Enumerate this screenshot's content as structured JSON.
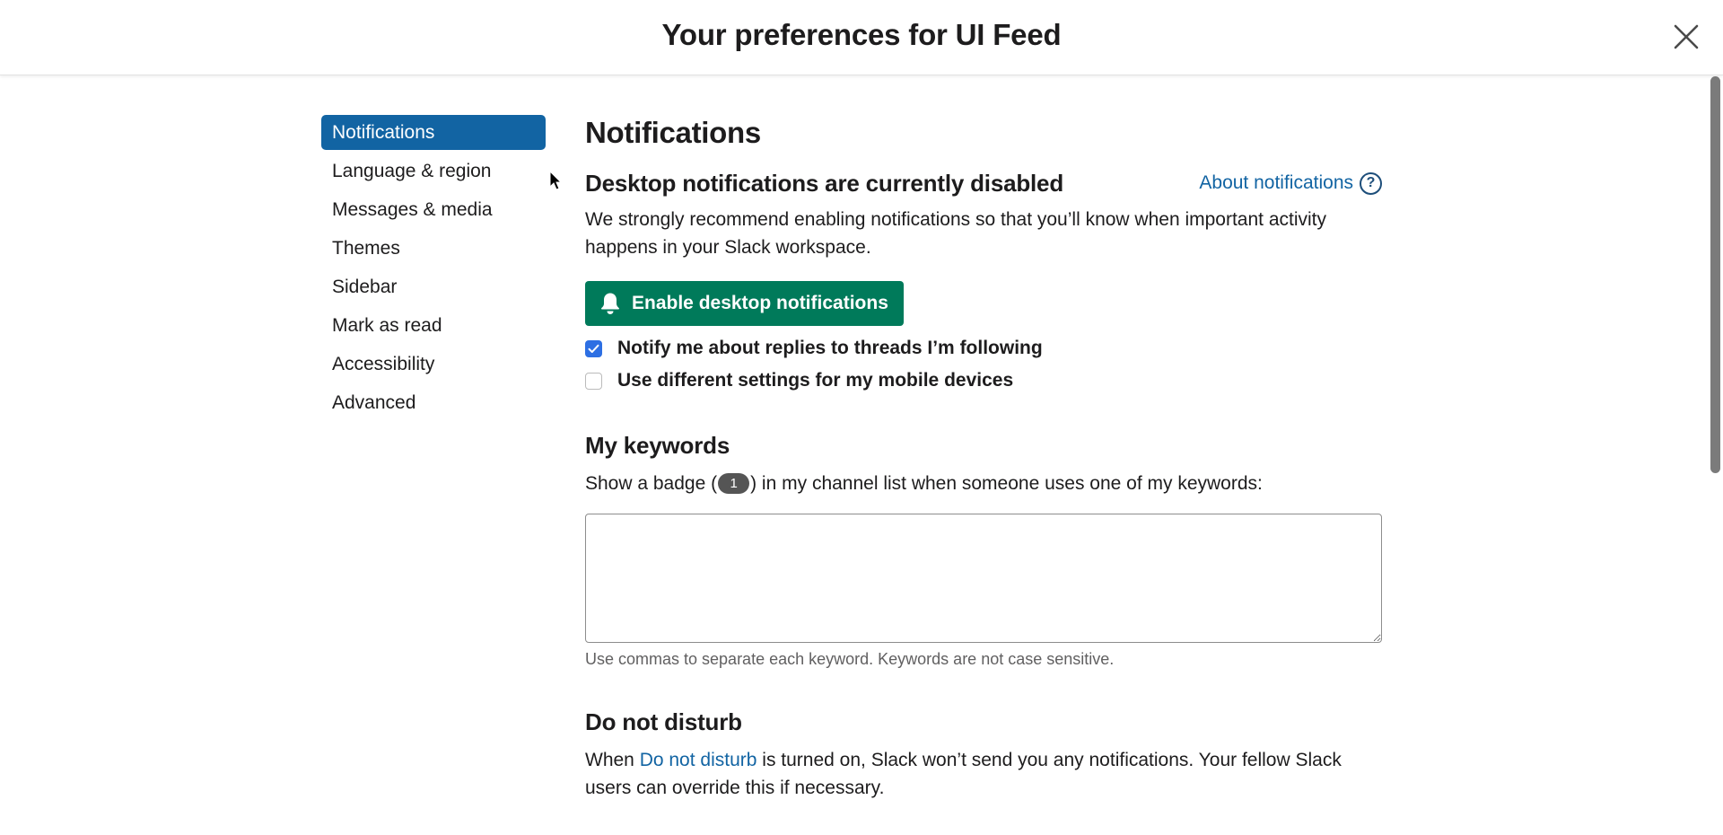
{
  "header": {
    "title": "Your preferences for UI Feed",
    "close_icon": "close-icon"
  },
  "sidebar": {
    "items": [
      {
        "label": "Notifications",
        "active": true
      },
      {
        "label": "Language & region",
        "active": false
      },
      {
        "label": "Messages & media",
        "active": false
      },
      {
        "label": "Themes",
        "active": false
      },
      {
        "label": "Sidebar",
        "active": false
      },
      {
        "label": "Mark as read",
        "active": false
      },
      {
        "label": "Accessibility",
        "active": false
      },
      {
        "label": "Advanced",
        "active": false
      }
    ]
  },
  "main": {
    "title": "Notifications",
    "desktop": {
      "title": "Desktop notifications are currently disabled",
      "about_link": "About notifications",
      "about_icon": "help-circle-icon",
      "description": "We strongly recommend enabling notifications so that you’ll know when important activity happens in your Slack workspace.",
      "enable_button": "Enable desktop notifications",
      "enable_icon": "bell-icon"
    },
    "checkboxes": [
      {
        "label": "Notify me about replies to threads I’m following",
        "checked": true
      },
      {
        "label": "Use different settings for my mobile devices",
        "checked": false
      }
    ],
    "keywords": {
      "title": "My keywords",
      "desc_before": "Show a badge (",
      "badge": "1",
      "desc_after": ") in my channel list when someone uses one of my keywords:",
      "value": "",
      "placeholder": "",
      "hint": "Use commas to separate each keyword. Keywords are not case sensitive."
    },
    "dnd": {
      "title": "Do not disturb",
      "desc_before": "When ",
      "link": "Do not disturb",
      "desc_after": " is turned on, Slack won’t send you any notifications. Your fellow Slack users can override this if necessary."
    }
  },
  "colors": {
    "accent_blue": "#1264a3",
    "enable_green": "#007a5a",
    "checkbox_blue": "#2d6fe3",
    "badge_gray": "#555555"
  }
}
